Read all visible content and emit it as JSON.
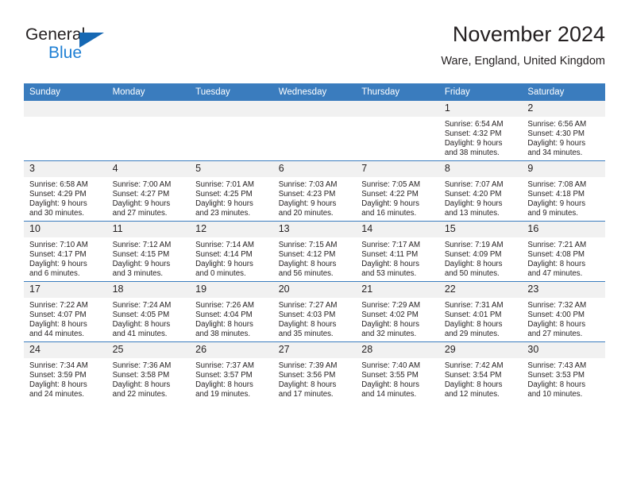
{
  "logo": {
    "word_one": "General",
    "word_two": "Blue",
    "triangle": "triangle-mark",
    "accent_dark": "#1668b3",
    "accent_light": "#1e7fd4"
  },
  "header": {
    "title": "November 2024",
    "subtitle": "Ware, England, United Kingdom"
  },
  "theme": {
    "header_blue": "#3a7cbe",
    "daynum_band": "#f1f1f1",
    "text": "#231f20"
  },
  "weekday_headers": [
    "Sunday",
    "Monday",
    "Tuesday",
    "Wednesday",
    "Thursday",
    "Friday",
    "Saturday"
  ],
  "weeks": [
    [
      {
        "day": "",
        "lines": []
      },
      {
        "day": "",
        "lines": []
      },
      {
        "day": "",
        "lines": []
      },
      {
        "day": "",
        "lines": []
      },
      {
        "day": "",
        "lines": []
      },
      {
        "day": "1",
        "lines": [
          "Sunrise: 6:54 AM",
          "Sunset: 4:32 PM",
          "Daylight: 9 hours",
          "and 38 minutes."
        ]
      },
      {
        "day": "2",
        "lines": [
          "Sunrise: 6:56 AM",
          "Sunset: 4:30 PM",
          "Daylight: 9 hours",
          "and 34 minutes."
        ]
      }
    ],
    [
      {
        "day": "3",
        "lines": [
          "Sunrise: 6:58 AM",
          "Sunset: 4:29 PM",
          "Daylight: 9 hours",
          "and 30 minutes."
        ]
      },
      {
        "day": "4",
        "lines": [
          "Sunrise: 7:00 AM",
          "Sunset: 4:27 PM",
          "Daylight: 9 hours",
          "and 27 minutes."
        ]
      },
      {
        "day": "5",
        "lines": [
          "Sunrise: 7:01 AM",
          "Sunset: 4:25 PM",
          "Daylight: 9 hours",
          "and 23 minutes."
        ]
      },
      {
        "day": "6",
        "lines": [
          "Sunrise: 7:03 AM",
          "Sunset: 4:23 PM",
          "Daylight: 9 hours",
          "and 20 minutes."
        ]
      },
      {
        "day": "7",
        "lines": [
          "Sunrise: 7:05 AM",
          "Sunset: 4:22 PM",
          "Daylight: 9 hours",
          "and 16 minutes."
        ]
      },
      {
        "day": "8",
        "lines": [
          "Sunrise: 7:07 AM",
          "Sunset: 4:20 PM",
          "Daylight: 9 hours",
          "and 13 minutes."
        ]
      },
      {
        "day": "9",
        "lines": [
          "Sunrise: 7:08 AM",
          "Sunset: 4:18 PM",
          "Daylight: 9 hours",
          "and 9 minutes."
        ]
      }
    ],
    [
      {
        "day": "10",
        "lines": [
          "Sunrise: 7:10 AM",
          "Sunset: 4:17 PM",
          "Daylight: 9 hours",
          "and 6 minutes."
        ]
      },
      {
        "day": "11",
        "lines": [
          "Sunrise: 7:12 AM",
          "Sunset: 4:15 PM",
          "Daylight: 9 hours",
          "and 3 minutes."
        ]
      },
      {
        "day": "12",
        "lines": [
          "Sunrise: 7:14 AM",
          "Sunset: 4:14 PM",
          "Daylight: 9 hours",
          "and 0 minutes."
        ]
      },
      {
        "day": "13",
        "lines": [
          "Sunrise: 7:15 AM",
          "Sunset: 4:12 PM",
          "Daylight: 8 hours",
          "and 56 minutes."
        ]
      },
      {
        "day": "14",
        "lines": [
          "Sunrise: 7:17 AM",
          "Sunset: 4:11 PM",
          "Daylight: 8 hours",
          "and 53 minutes."
        ]
      },
      {
        "day": "15",
        "lines": [
          "Sunrise: 7:19 AM",
          "Sunset: 4:09 PM",
          "Daylight: 8 hours",
          "and 50 minutes."
        ]
      },
      {
        "day": "16",
        "lines": [
          "Sunrise: 7:21 AM",
          "Sunset: 4:08 PM",
          "Daylight: 8 hours",
          "and 47 minutes."
        ]
      }
    ],
    [
      {
        "day": "17",
        "lines": [
          "Sunrise: 7:22 AM",
          "Sunset: 4:07 PM",
          "Daylight: 8 hours",
          "and 44 minutes."
        ]
      },
      {
        "day": "18",
        "lines": [
          "Sunrise: 7:24 AM",
          "Sunset: 4:05 PM",
          "Daylight: 8 hours",
          "and 41 minutes."
        ]
      },
      {
        "day": "19",
        "lines": [
          "Sunrise: 7:26 AM",
          "Sunset: 4:04 PM",
          "Daylight: 8 hours",
          "and 38 minutes."
        ]
      },
      {
        "day": "20",
        "lines": [
          "Sunrise: 7:27 AM",
          "Sunset: 4:03 PM",
          "Daylight: 8 hours",
          "and 35 minutes."
        ]
      },
      {
        "day": "21",
        "lines": [
          "Sunrise: 7:29 AM",
          "Sunset: 4:02 PM",
          "Daylight: 8 hours",
          "and 32 minutes."
        ]
      },
      {
        "day": "22",
        "lines": [
          "Sunrise: 7:31 AM",
          "Sunset: 4:01 PM",
          "Daylight: 8 hours",
          "and 29 minutes."
        ]
      },
      {
        "day": "23",
        "lines": [
          "Sunrise: 7:32 AM",
          "Sunset: 4:00 PM",
          "Daylight: 8 hours",
          "and 27 minutes."
        ]
      }
    ],
    [
      {
        "day": "24",
        "lines": [
          "Sunrise: 7:34 AM",
          "Sunset: 3:59 PM",
          "Daylight: 8 hours",
          "and 24 minutes."
        ]
      },
      {
        "day": "25",
        "lines": [
          "Sunrise: 7:36 AM",
          "Sunset: 3:58 PM",
          "Daylight: 8 hours",
          "and 22 minutes."
        ]
      },
      {
        "day": "26",
        "lines": [
          "Sunrise: 7:37 AM",
          "Sunset: 3:57 PM",
          "Daylight: 8 hours",
          "and 19 minutes."
        ]
      },
      {
        "day": "27",
        "lines": [
          "Sunrise: 7:39 AM",
          "Sunset: 3:56 PM",
          "Daylight: 8 hours",
          "and 17 minutes."
        ]
      },
      {
        "day": "28",
        "lines": [
          "Sunrise: 7:40 AM",
          "Sunset: 3:55 PM",
          "Daylight: 8 hours",
          "and 14 minutes."
        ]
      },
      {
        "day": "29",
        "lines": [
          "Sunrise: 7:42 AM",
          "Sunset: 3:54 PM",
          "Daylight: 8 hours",
          "and 12 minutes."
        ]
      },
      {
        "day": "30",
        "lines": [
          "Sunrise: 7:43 AM",
          "Sunset: 3:53 PM",
          "Daylight: 8 hours",
          "and 10 minutes."
        ]
      }
    ]
  ]
}
